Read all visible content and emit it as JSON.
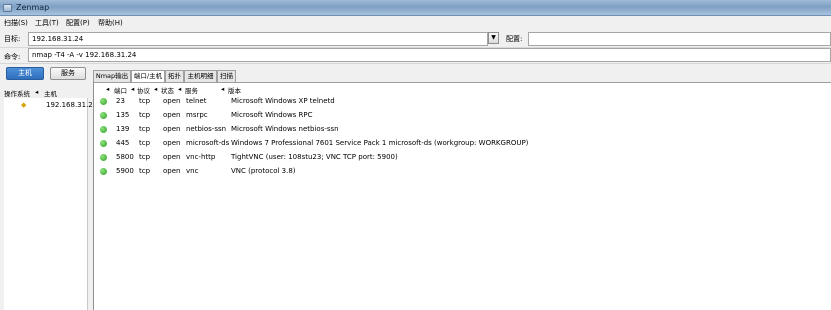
{
  "window": {
    "title": "Zenmap"
  },
  "menu": [
    {
      "label": "扫描(S)"
    },
    {
      "label": "工具(T)"
    },
    {
      "label": "配置(P)"
    },
    {
      "label": "帮助(H)"
    }
  ],
  "target": {
    "label": "目标:",
    "value": "192.168.31.24"
  },
  "profile": {
    "label": "配置:",
    "value": ""
  },
  "command": {
    "label": "命令:",
    "value": "nmap -T4 -A -v 192.168.31.24"
  },
  "left": {
    "hosts_button": "主机",
    "services_button": "服务",
    "col_os": "操作系统",
    "col_host": "主机",
    "hosts": [
      {
        "ip": "192.168.31.2"
      }
    ]
  },
  "tabs": [
    {
      "label": "Nmap输出",
      "active": false
    },
    {
      "label": "端口/主机",
      "active": true
    },
    {
      "label": "拓扑",
      "active": false
    },
    {
      "label": "主机明细",
      "active": false
    },
    {
      "label": "扫描",
      "active": false
    }
  ],
  "ports_table": {
    "headers": {
      "port": "端口",
      "protocol": "协议",
      "state": "状态",
      "service": "服务",
      "version": "版本"
    },
    "rows": [
      {
        "port": "23",
        "protocol": "tcp",
        "state": "open",
        "service": "telnet",
        "version": "Microsoft Windows XP telnetd"
      },
      {
        "port": "135",
        "protocol": "tcp",
        "state": "open",
        "service": "msrpc",
        "version": "Microsoft Windows RPC"
      },
      {
        "port": "139",
        "protocol": "tcp",
        "state": "open",
        "service": "netbios-ssn",
        "version": "Microsoft Windows netbios-ssn"
      },
      {
        "port": "445",
        "protocol": "tcp",
        "state": "open",
        "service": "microsoft-ds",
        "version": "Windows 7 Professional 7601 Service Pack 1 microsoft-ds (workgroup: WORKGROUP)"
      },
      {
        "port": "5800",
        "protocol": "tcp",
        "state": "open",
        "service": "vnc-http",
        "version": "TightVNC (user: 108stu23; VNC TCP port: 5900)"
      },
      {
        "port": "5900",
        "protocol": "tcp",
        "state": "open",
        "service": "vnc",
        "version": "VNC (protocol 3.8)"
      }
    ]
  },
  "colors": {
    "open_status": "#2e9e2a",
    "active_button": "#2f6fbc"
  }
}
